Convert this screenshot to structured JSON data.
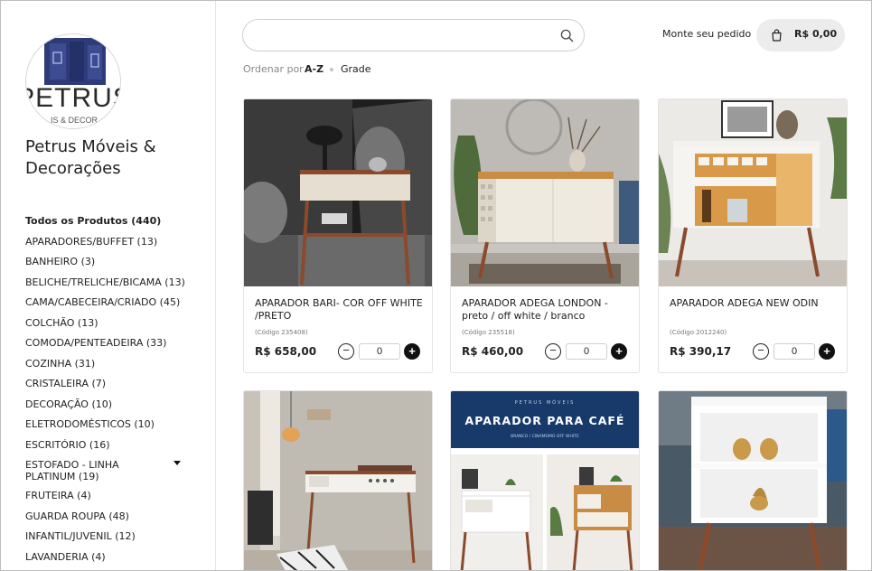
{
  "store": {
    "name": "Petrus Móveis & Decorações",
    "logo_text": "PETRUS",
    "logo_sub": "IS & DECOR"
  },
  "categories": [
    {
      "label": "Todos os Produtos (440)"
    },
    {
      "label": "APARADORES/BUFFET (13)"
    },
    {
      "label": "BANHEIRO (3)"
    },
    {
      "label": "BELICHE/TRELICHE/BICAMA (13)"
    },
    {
      "label": "CAMA/CABECEIRA/CRIADO (45)"
    },
    {
      "label": "COLCHÃO (13)"
    },
    {
      "label": "COMODA/PENTEADEIRA (33)"
    },
    {
      "label": "COZINHA (31)"
    },
    {
      "label": "CRISTALEIRA (7)"
    },
    {
      "label": "DECORAÇÃO (10)"
    },
    {
      "label": "ELETRODOMÉSTICOS (10)"
    },
    {
      "label": "ESCRITÓRIO (16)"
    },
    {
      "label": "ESTOFADO - LINHA PLATINUM (19)"
    },
    {
      "label": "FRUTEIRA (4)"
    },
    {
      "label": "GUARDA ROUPA (48)"
    },
    {
      "label": "INFANTIL/JUVENIL (12)"
    },
    {
      "label": "LAVANDERIA (4)"
    }
  ],
  "header": {
    "search_placeholder": "",
    "monte_label": "Monte seu pedido",
    "cart_total": "R$ 0,00"
  },
  "sort": {
    "label": "Ordenar por",
    "az": "A-Z",
    "grid": "Grade"
  },
  "products": [
    {
      "title": "APARADOR BARI- COR OFF WHITE /PRETO",
      "code": "(Código 235408)",
      "price": "R$ 658,00",
      "qty": "0"
    },
    {
      "title": "APARADOR ADEGA LONDON - preto / off white / branco",
      "code": "(Código 235518)",
      "price": "R$ 460,00",
      "qty": "0"
    },
    {
      "title": "APARADOR ADEGA NEW ODIN",
      "code": "(Código 2012240)",
      "price": "R$ 390,17",
      "qty": "0"
    }
  ],
  "promo_banner": {
    "small": "PETRUS MÓVEIS",
    "title": "APARADOR PARA CAFÉ",
    "sub": "BRANCO / CINAMOMO OFF WHITE"
  },
  "colors": {
    "accent": "#111111",
    "banner_blue": "#173a6b",
    "wood": "#8a4a2b"
  }
}
